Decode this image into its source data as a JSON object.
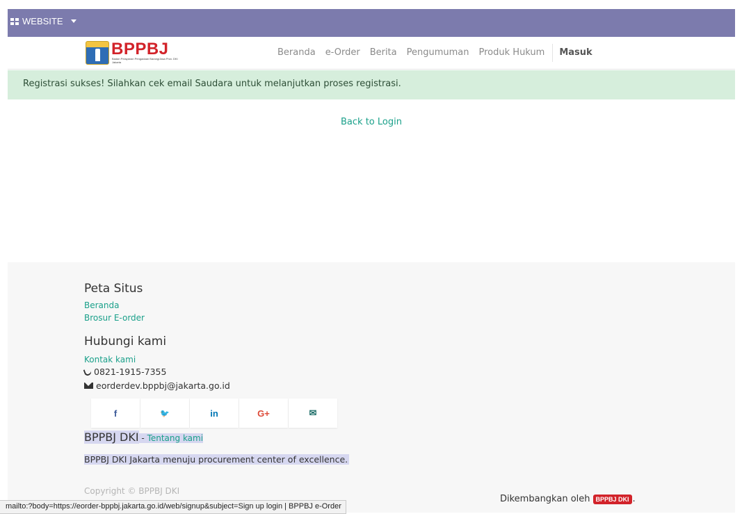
{
  "topbar": {
    "menu_label": "WEBSITE"
  },
  "logo": {
    "brand": "BPPBJ",
    "tagline": "Badan Pelayanan Pengadaan Barang/Jasa Prov. DKI Jakarta"
  },
  "nav": {
    "items": [
      "Beranda",
      "e-Order",
      "Berita",
      "Pengumuman",
      "Produk Hukum"
    ],
    "login": "Masuk"
  },
  "alert": {
    "message": "Registrasi sukses! Silahkan cek email Saudara untuk melanjutkan proses registrasi."
  },
  "main": {
    "back_link": "Back to Login"
  },
  "footer": {
    "sitemap_title": "Peta Situs",
    "sitemap_links": [
      "Beranda",
      "Brosur E-order"
    ],
    "contact_title": "Hubungi kami",
    "contact_link": "Kontak kami",
    "phone": "0821-1915-7355",
    "email": "eorderdev.bppbj@jakarta.go.id",
    "social": [
      {
        "glyph": "f",
        "icon": "facebook-icon",
        "color": "#3b5998"
      },
      {
        "glyph": "🐦",
        "icon": "twitter-icon",
        "color": "#1da1f2"
      },
      {
        "glyph": "in",
        "icon": "linkedin-icon",
        "color": "#0077b5"
      },
      {
        "glyph": "G+",
        "icon": "google-plus-icon",
        "color": "#dd4b39"
      },
      {
        "glyph": "✉",
        "icon": "email-icon",
        "color": "#1f6f6a"
      }
    ],
    "org_name": "BPPBJ DKI",
    "org_sep": " - ",
    "about_link": "Tentang kami",
    "mission": "BPPBJ DKI Jakarta menuju procurement center of excellence.",
    "copyright": "Copyright © BPPBJ DKI",
    "developed_by": "Dikembangkan oleh",
    "developer_badge": "BPPBJ DKI",
    "developer_suffix": "."
  },
  "status_bar": {
    "url": "mailto:?body=https://eorder-bppbj.jakarta.go.id/web/signup&subject=Sign up login | BPPBJ e-Order"
  },
  "colors": {
    "topbar": "#7c7bad",
    "accent": "#1aa08a",
    "alert_bg": "#d6eedc",
    "brand_red": "#d2232a"
  }
}
